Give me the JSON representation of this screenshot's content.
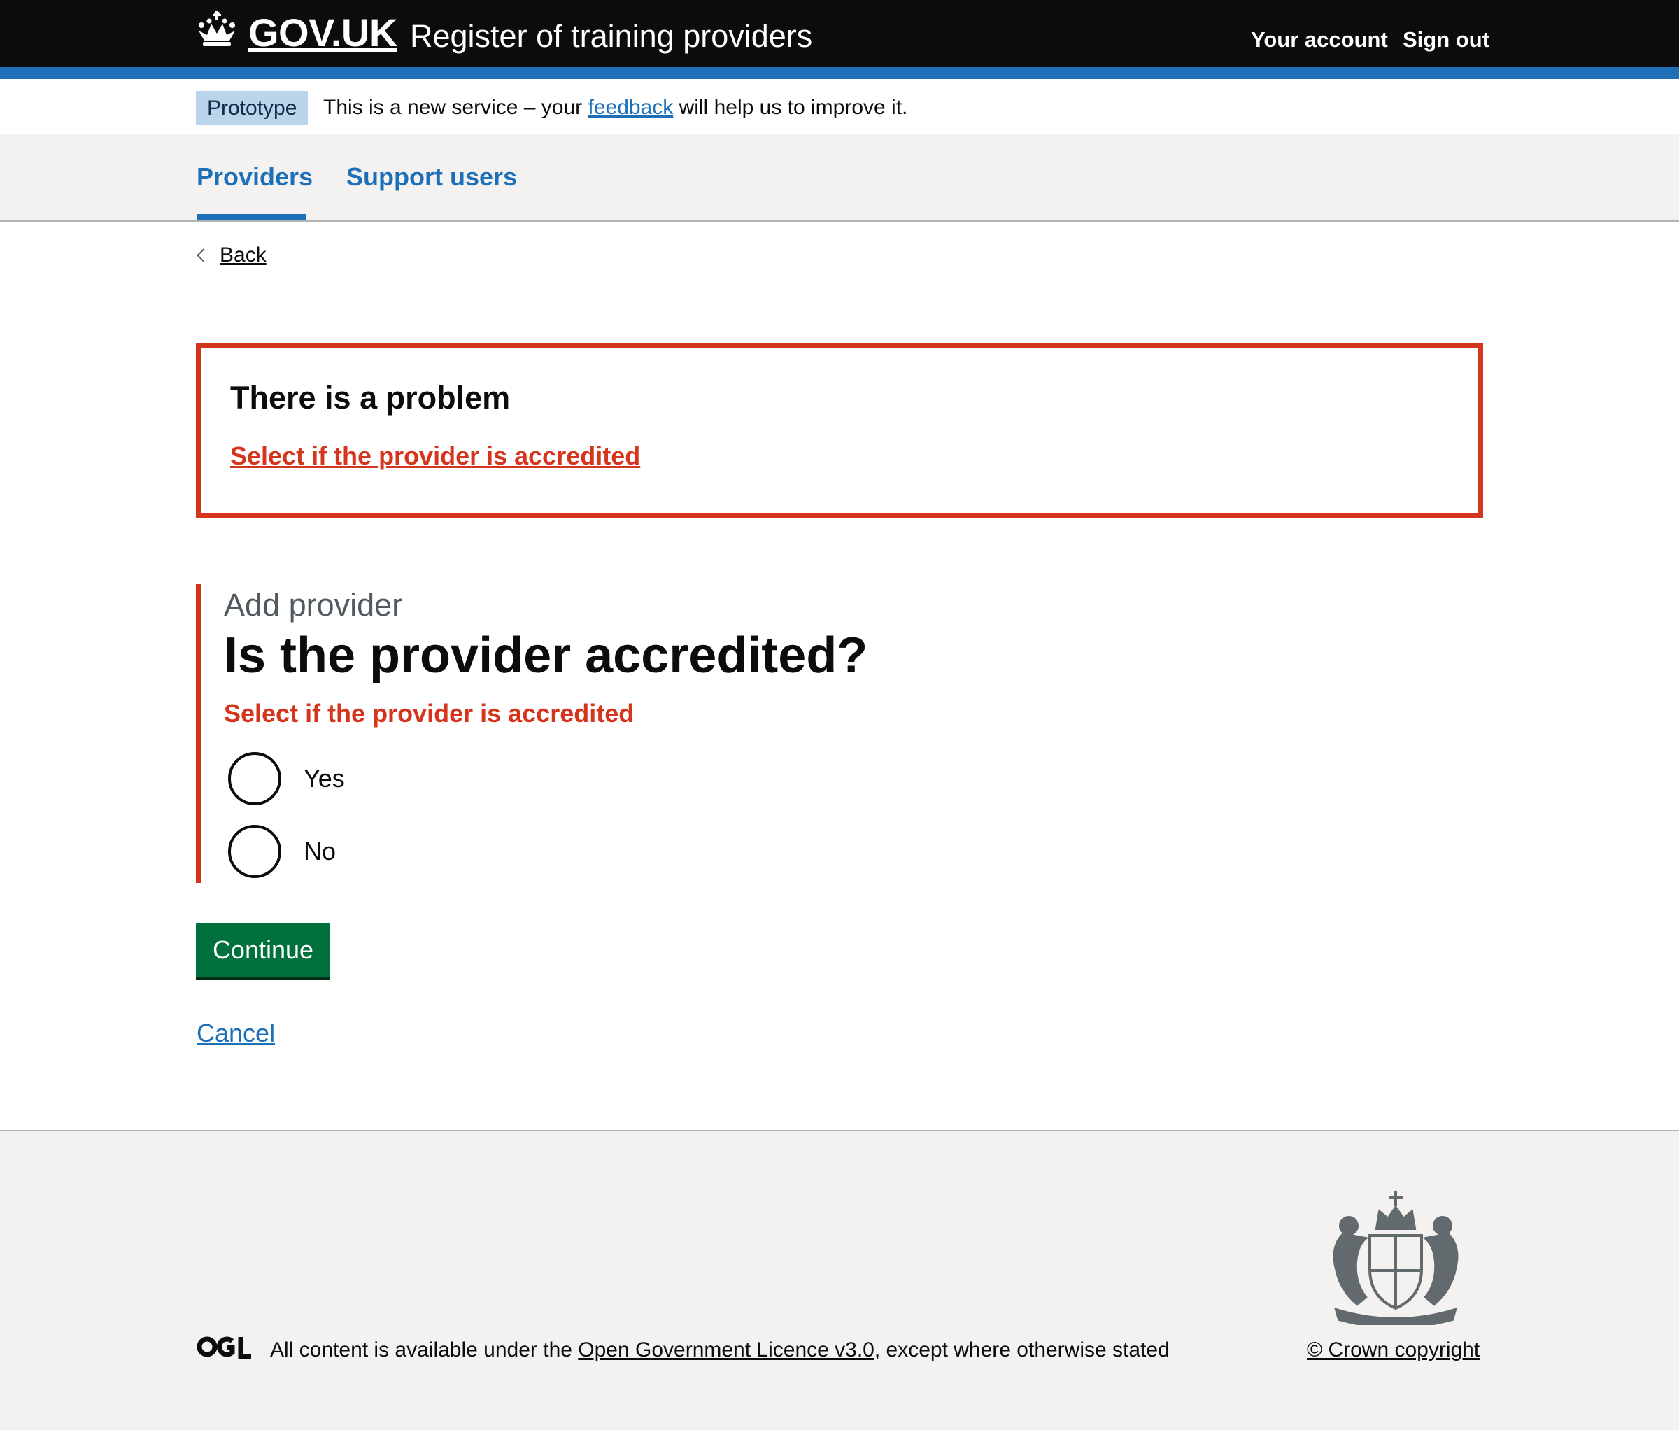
{
  "header": {
    "logo": "GOV.UK",
    "service_name": "Register of training providers",
    "links": [
      "Your account",
      "Sign out"
    ]
  },
  "phase_banner": {
    "tag": "Prototype",
    "text_before": "This is a new service – your ",
    "link": "feedback",
    "text_after": " will help us to improve it."
  },
  "nav": {
    "items": [
      {
        "label": "Providers",
        "active": true
      },
      {
        "label": "Support users",
        "active": false
      }
    ]
  },
  "back_link": "Back",
  "error_summary": {
    "title": "There is a problem",
    "link": "Select if the provider is accredited"
  },
  "form": {
    "caption": "Add provider",
    "question": "Is the provider accredited?",
    "error_message": "Select if the provider is accredited",
    "options": [
      "Yes",
      "No"
    ],
    "continue_label": "Continue",
    "cancel_label": "Cancel"
  },
  "footer": {
    "licence_before": "All content is available under the ",
    "licence_link": "Open Government Licence v3.0",
    "licence_after": ", except where otherwise stated",
    "copyright": "© Crown copyright"
  },
  "colors": {
    "header": "#0b0c0c",
    "brand_blue": "#1d70b8",
    "error_red": "#d4351c",
    "button_green": "#00703c",
    "footer_bg": "#f3f2f1",
    "tag_bg": "#bbd4ea"
  }
}
